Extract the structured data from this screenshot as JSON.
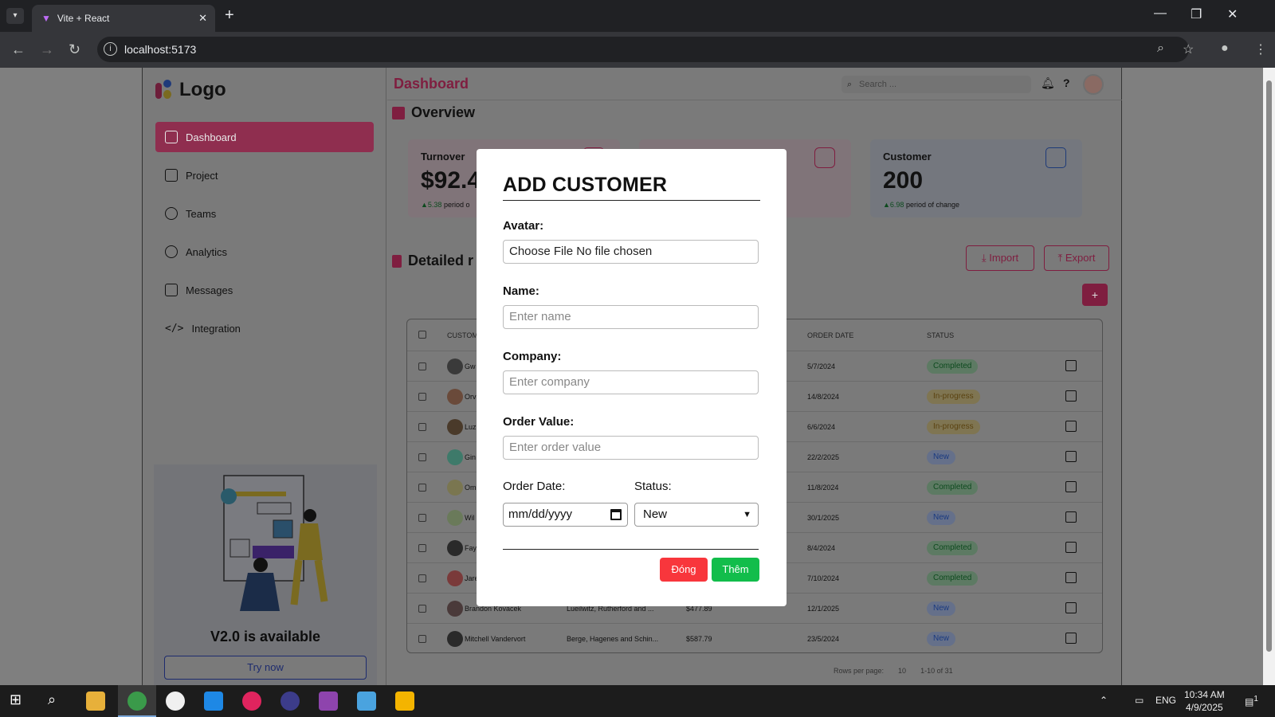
{
  "browser": {
    "tab_title": "Vite + React",
    "tab_close": "✕",
    "new_tab": "+",
    "url": "localhost:5173",
    "window_controls": [
      "—",
      "❐",
      "✕"
    ]
  },
  "sidebar": {
    "logo": "Logo",
    "items": [
      {
        "label": "Dashboard",
        "active": true
      },
      {
        "label": "Project"
      },
      {
        "label": "Teams"
      },
      {
        "label": "Analytics"
      },
      {
        "label": "Messages"
      },
      {
        "label": "Integration"
      }
    ],
    "promo": {
      "title": "V2.0 is available",
      "button": "Try now"
    }
  },
  "header": {
    "title": "Dashboard",
    "search_placeholder": "Search ...",
    "help": "?"
  },
  "overview": {
    "title": "Overview",
    "cards": [
      {
        "label": "Turnover",
        "value": "$92.4",
        "change": "▲5.38",
        "note": "period o"
      },
      {
        "label": "",
        "value": "",
        "change": "",
        "note": ""
      },
      {
        "label": "Customer",
        "value": "200",
        "change": "▲6.98",
        "note": "period of change"
      }
    ]
  },
  "report": {
    "title": "Detailed r",
    "import": "⤓ Import",
    "export": "⤒ Export",
    "add": "+",
    "columns": [
      "CUSTOM",
      "ORDER DATE",
      "STATUS"
    ],
    "rows": [
      {
        "name": "Gw",
        "company": "",
        "value": "",
        "date": "5/7/2024",
        "status": "Completed"
      },
      {
        "name": "Orv",
        "company": "",
        "value": "",
        "date": "14/8/2024",
        "status": "In-progress"
      },
      {
        "name": "Luz",
        "company": "",
        "value": "",
        "date": "6/6/2024",
        "status": "In-progress"
      },
      {
        "name": "Gin",
        "company": "",
        "value": "",
        "date": "22/2/2025",
        "status": "New"
      },
      {
        "name": "Om",
        "company": "",
        "value": "",
        "date": "11/8/2024",
        "status": "Completed"
      },
      {
        "name": "Wil",
        "company": "",
        "value": "",
        "date": "30/1/2025",
        "status": "New"
      },
      {
        "name": "Fay",
        "company": "",
        "value": "",
        "date": "8/4/2024",
        "status": "Completed"
      },
      {
        "name": "Jare",
        "company": "",
        "value": "",
        "date": "7/10/2024",
        "status": "Completed"
      },
      {
        "name": "Brandon Kovacek",
        "company": "Lueilwitz, Rutherford and ...",
        "value": "$477.89",
        "date": "12/1/2025",
        "status": "New"
      },
      {
        "name": "Mitchell Vandervort",
        "company": "Berge, Hagenes and Schin...",
        "value": "$587.79",
        "date": "23/5/2024",
        "status": "New"
      }
    ],
    "pager": {
      "rows_per_page": "Rows per page:",
      "rows": "10",
      "range": "1-10 of 31"
    }
  },
  "modal": {
    "title": "ADD CUSTOMER",
    "avatar_label": "Avatar:",
    "file_value": "Choose File No file chosen",
    "name_label": "Name:",
    "name_placeholder": "Enter name",
    "company_label": "Company:",
    "company_placeholder": "Enter company",
    "order_value_label": "Order Value:",
    "order_value_placeholder": "Enter order value",
    "order_date_label": "Order Date:",
    "order_date_value": "mm/dd/yyyy",
    "status_label": "Status:",
    "status_value": "New",
    "close_button": "Đóng",
    "add_button": "Thêm"
  },
  "taskbar": {
    "lang": "ENG",
    "time": "10:34 AM",
    "date": "4/9/2025",
    "notif_count": "1"
  }
}
